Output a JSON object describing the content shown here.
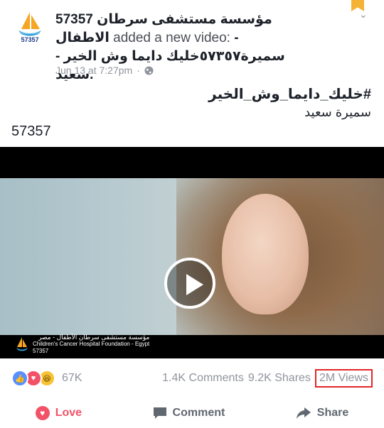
{
  "post": {
    "page_name": "57357 مؤسسة مستشفى سرطان الاطفال",
    "action_text": "added a new video:",
    "video_title": "- سميرة٥٧٣٥٧خليك دايما وش الخير - سعيد.",
    "timestamp": "Jun 13 at 7:27pm",
    "separator": "·",
    "avatar_label": "57357",
    "hashtag": "#خليك_دايما_وش_الخير",
    "artist": "سميرة سعيد",
    "post_number": "57357"
  },
  "video": {
    "logo_number": "57357",
    "logo_text_ar": "مؤسسة مستشفى سرطان الأطفال - مصر",
    "logo_text_en": "Children's Cancer Hospital Foundation - Egypt"
  },
  "reactions": {
    "count": "67K",
    "comments": "1.4K Comments",
    "shares": "9.2K Shares",
    "views": "2M Views"
  },
  "actions": {
    "love": "Love",
    "comment": "Comment",
    "share": "Share"
  },
  "colors": {
    "love": "#f25268",
    "like": "#5890ff",
    "haha": "#f7c234",
    "views_highlight": "#e32626",
    "bookmark": "#f5b335"
  }
}
